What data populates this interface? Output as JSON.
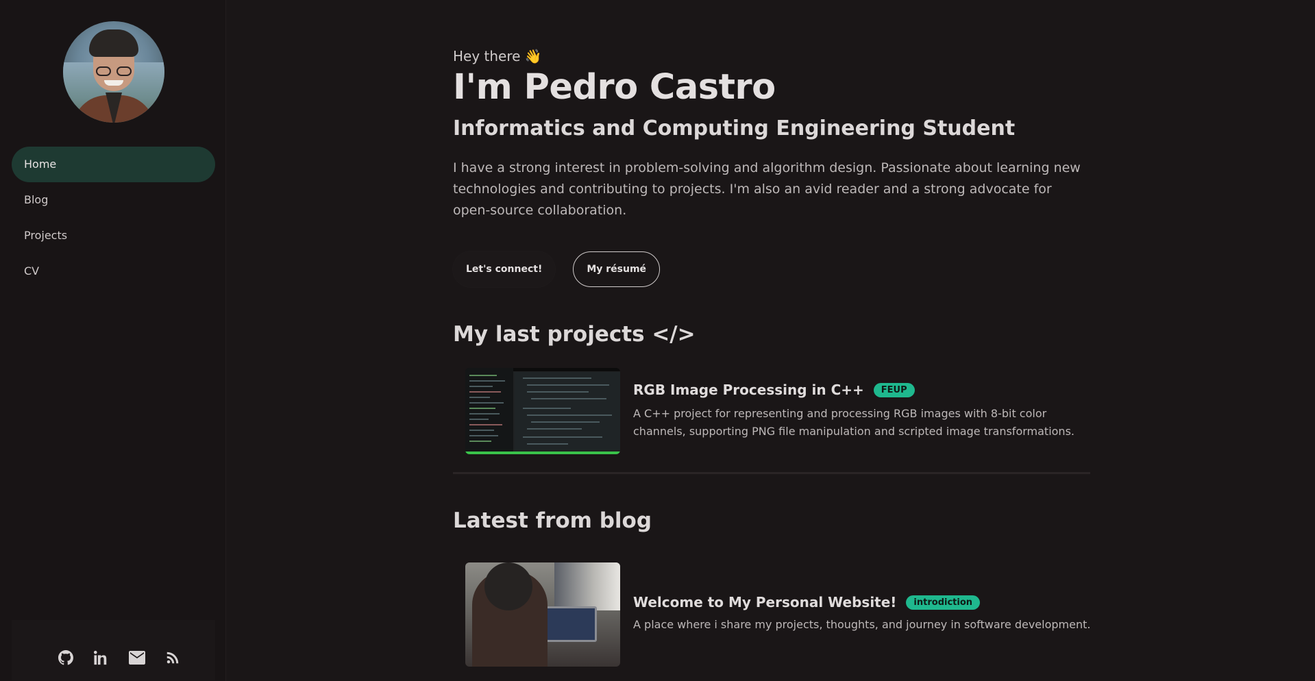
{
  "sidebar": {
    "nav": [
      "Home",
      "Blog",
      "Projects",
      "CV"
    ],
    "active": "Home",
    "social": [
      "github-icon",
      "linkedin-icon",
      "mail-icon",
      "rss-icon"
    ]
  },
  "hero": {
    "greeting": "Hey there 👋",
    "name": "I'm Pedro Castro",
    "role": "Informatics and Computing Engineering Student",
    "bio": "I have a strong interest in problem-solving and algorithm design. Passionate about learning new technologies and contributing to projects. I'm also an avid reader and a strong advocate for open-source collaboration.",
    "connect_button": "Let's connect!",
    "resume_button": "My résumé"
  },
  "projects": {
    "title": "My last projects </>",
    "items": [
      {
        "title": "RGB Image Processing in C++",
        "tag": "FEUP",
        "description": "A C++ project for representing and processing RGB images with 8-bit color channels, supporting PNG file manipulation and scripted image transformations."
      }
    ]
  },
  "blog": {
    "title": "Latest from blog",
    "items": [
      {
        "title": "Welcome to My Personal Website!",
        "tag": "introdiction",
        "description": "A place where i share my projects, thoughts, and journey in software development."
      }
    ]
  },
  "colors": {
    "background": "#1a1617",
    "sidebar": "#181415",
    "nav_active": "#1e3a32",
    "tag": "#1fb88e"
  }
}
